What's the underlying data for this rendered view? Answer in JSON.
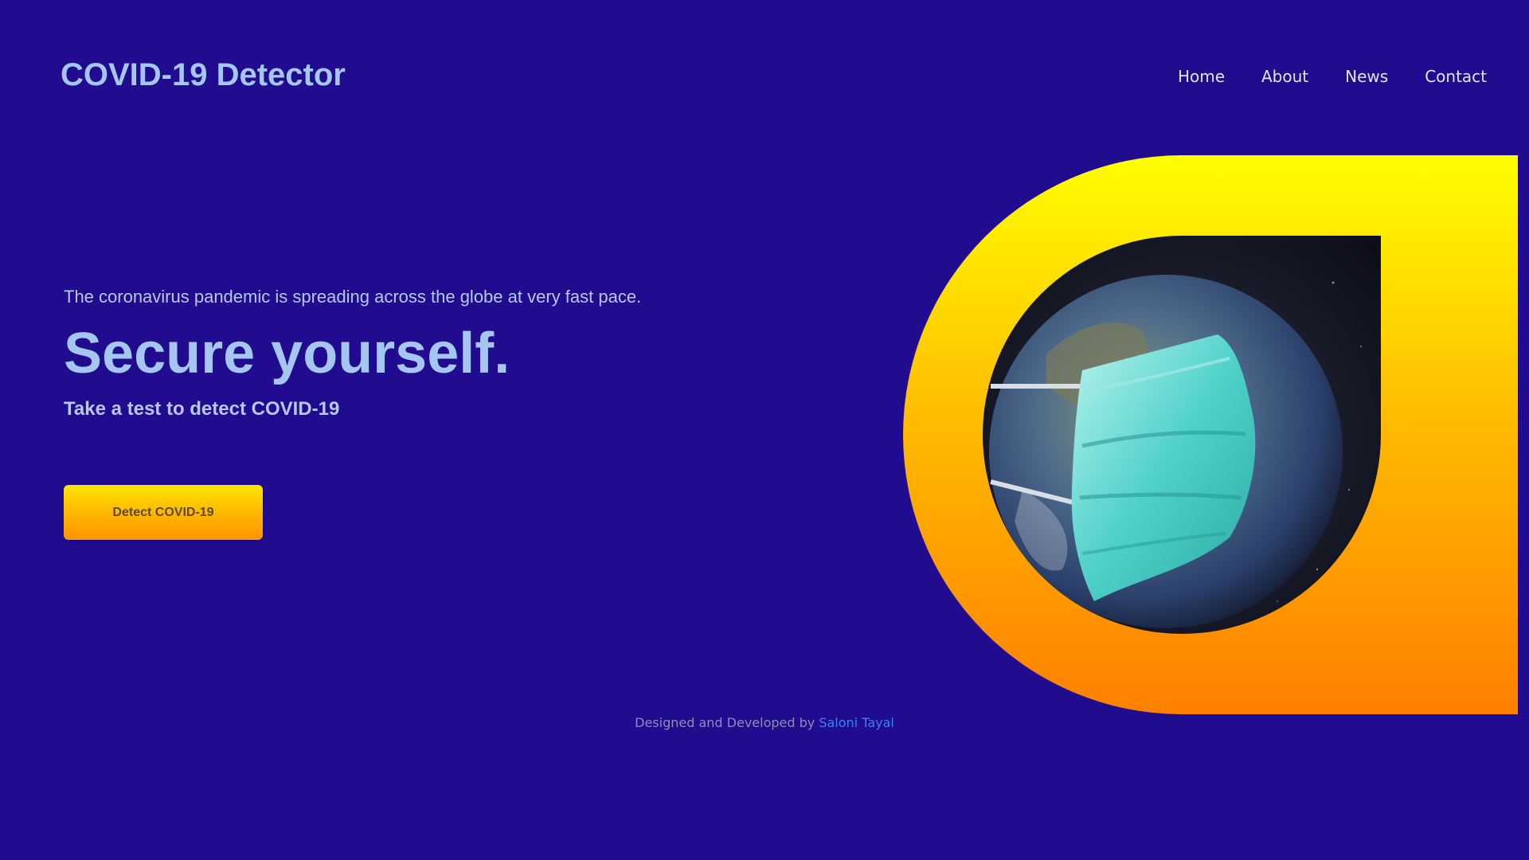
{
  "header": {
    "brand": "COVID-19 Detector",
    "nav": [
      "Home",
      "About",
      "News",
      "Contact"
    ]
  },
  "hero": {
    "tagline": "The coronavirus pandemic is spreading across the globe at very fast pace.",
    "headline": "Secure yourself.",
    "subhead": "Take a test to detect COVID-19",
    "cta_label": "Detect COVID-19"
  },
  "footer": {
    "prefix": "Designed and Developed by",
    "author": "Saloni Tayal"
  },
  "colors": {
    "background": "#210b8e",
    "brand_text": "#a4c6f0",
    "accent_yellow": "#ffff00",
    "accent_orange": "#ff7f00",
    "link": "#3a82f7"
  },
  "icons": {
    "hero_image": "masked-earth-illustration"
  }
}
